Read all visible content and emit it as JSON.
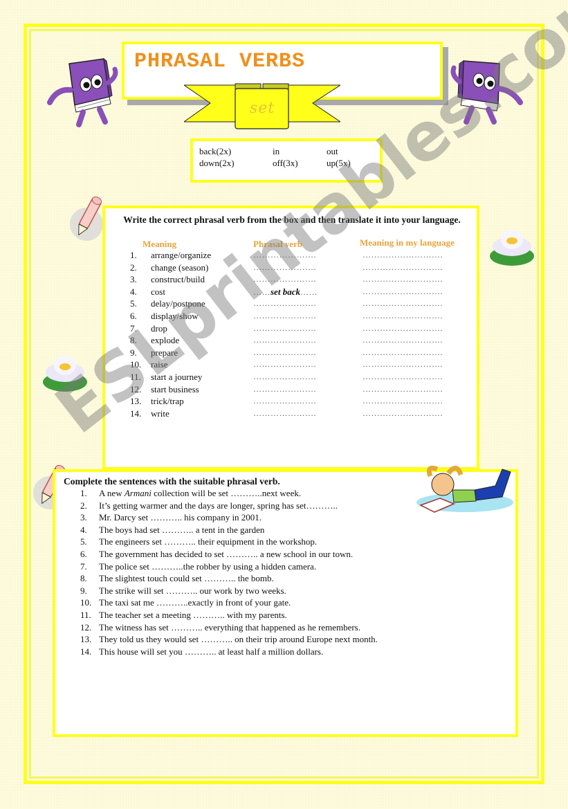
{
  "header": {
    "title": "PHRASAL  VERBS",
    "banner_word": "set"
  },
  "word_box": {
    "items": [
      "back(2x)",
      "in",
      "out",
      "down(2x)",
      "off(3x)",
      "up(5x)"
    ]
  },
  "exercise1": {
    "instruction": "Write the correct phrasal verb from the box and then translate it into your language.",
    "columns": [
      "Meaning",
      "Phrasal verb",
      "Meaning in my language"
    ],
    "blank_pv": "………………….",
    "blank_tr": "……………………….",
    "rows": [
      {
        "num": "1.",
        "meaning": "arrange/organize",
        "answer": ""
      },
      {
        "num": "2.",
        "meaning": "change (season)",
        "answer": ""
      },
      {
        "num": "3.",
        "meaning": "construct/build",
        "answer": ""
      },
      {
        "num": "4.",
        "meaning": "cost",
        "answer": "set back"
      },
      {
        "num": "5.",
        "meaning": "delay/postpone",
        "answer": ""
      },
      {
        "num": "6.",
        "meaning": "display/show",
        "answer": ""
      },
      {
        "num": "7.",
        "meaning": "drop",
        "answer": ""
      },
      {
        "num": "8.",
        "meaning": "explode",
        "answer": ""
      },
      {
        "num": "9.",
        "meaning": "prepare",
        "answer": ""
      },
      {
        "num": "10.",
        "meaning": "raise",
        "answer": ""
      },
      {
        "num": "11.",
        "meaning": "start a journey",
        "answer": ""
      },
      {
        "num": "12.",
        "meaning": "start business",
        "answer": ""
      },
      {
        "num": "13.",
        "meaning": "trick/trap",
        "answer": ""
      },
      {
        "num": "14.",
        "meaning": "write",
        "answer": ""
      }
    ]
  },
  "exercise2": {
    "instruction": "Complete the sentences with the suitable phrasal verb.",
    "sentences": [
      {
        "num": "1.",
        "pre": "A new ",
        "em": "Armani",
        "post": " collection will be set ………..next week."
      },
      {
        "num": "2.",
        "pre": "It’s getting warmer and the days are longer, spring has set………..",
        "em": "",
        "post": ""
      },
      {
        "num": "3.",
        "pre": "Mr. Darcy set ……….. his company in 2001.",
        "em": "",
        "post": ""
      },
      {
        "num": "4.",
        "pre": "The boys had set ……….. a tent in the garden",
        "em": "",
        "post": ""
      },
      {
        "num": "5.",
        "pre": "The engineers set ……….. their equipment in the workshop.",
        "em": "",
        "post": ""
      },
      {
        "num": "6.",
        "pre": "The government has decided to set ……….. a new school in our town.",
        "em": "",
        "post": ""
      },
      {
        "num": "7.",
        "pre": "The police set ………..the robber by using a hidden camera.",
        "em": "",
        "post": ""
      },
      {
        "num": "8.",
        "pre": "The slightest touch could set ……….. the bomb.",
        "em": "",
        "post": ""
      },
      {
        "num": "9.",
        "pre": "The strike will set ……….. our work by two weeks.",
        "em": "",
        "post": ""
      },
      {
        "num": "10.",
        "pre": "The taxi sat me ………..exactly in front of your gate.",
        "em": "",
        "post": ""
      },
      {
        "num": "11.",
        "pre": "The teacher set a meeting ……….. with my parents.",
        "em": "",
        "post": ""
      },
      {
        "num": "12.",
        "pre": "The witness has set ……….. everything that happened as he remembers.",
        "em": "",
        "post": ""
      },
      {
        "num": "13.",
        "pre": "They told us they would set ……….. on their trip around Europe next month.",
        "em": "",
        "post": ""
      },
      {
        "num": "14.",
        "pre": "This house will set you ……….. at least half a million dollars.",
        "em": "",
        "post": ""
      }
    ]
  },
  "watermark": "ESLprintables.com",
  "colors": {
    "border_yellow": "#ffff1a",
    "title_orange": "#f0901c",
    "header_orange": "#e8a33a",
    "book_purple": "#8a4fb8"
  }
}
